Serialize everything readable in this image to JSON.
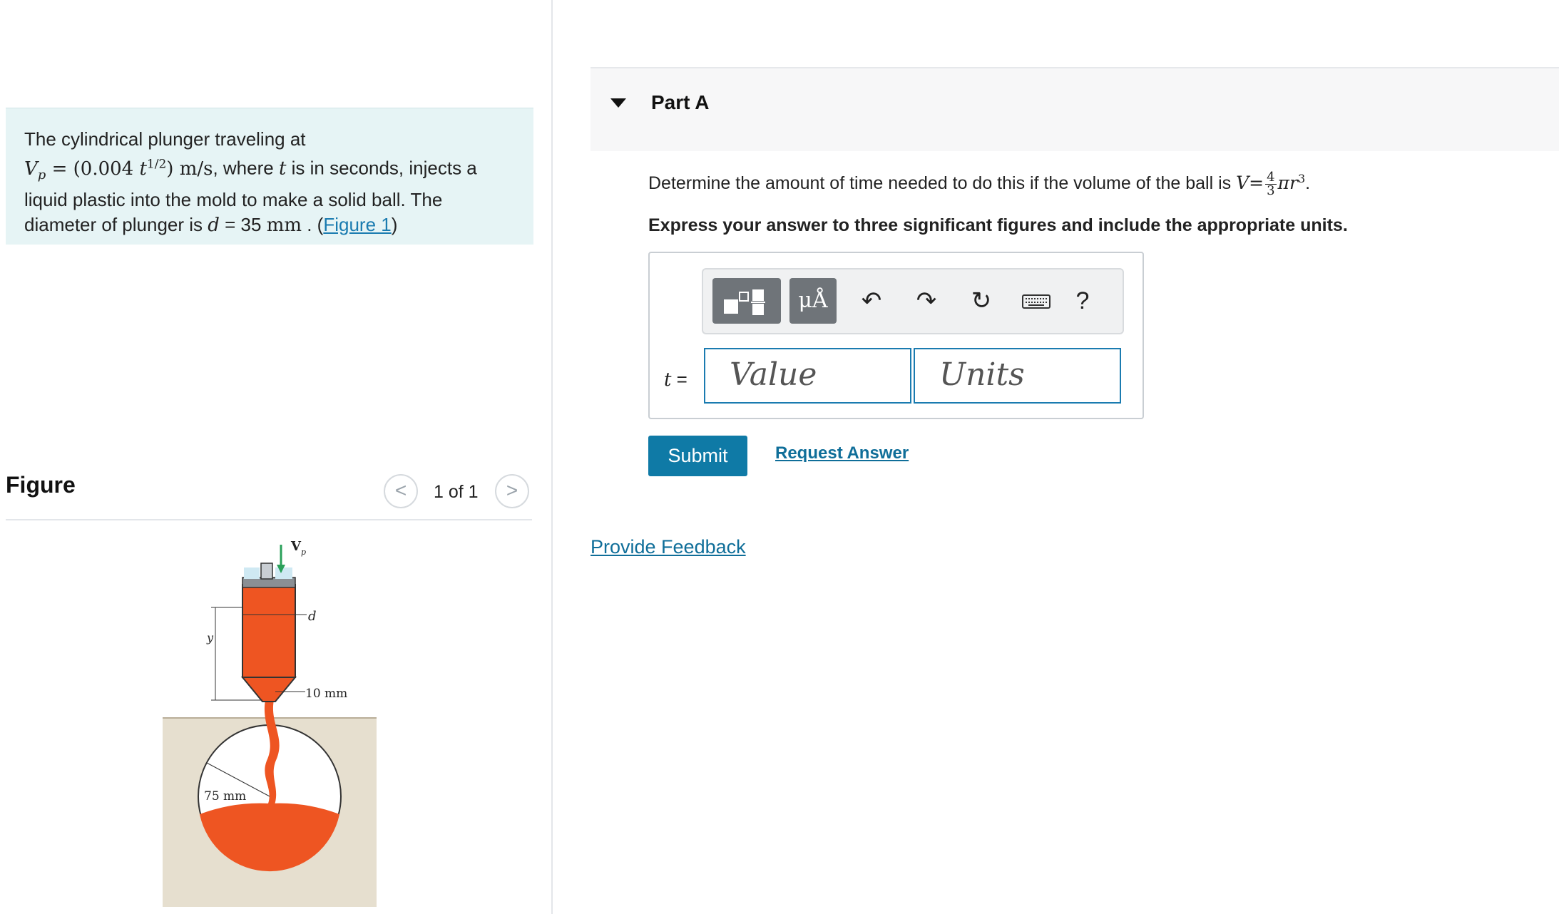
{
  "problem": {
    "intro": "The cylindrical plunger traveling at",
    "speed_var": "V",
    "speed_sub": "p",
    "speed_expr_open": " = (0.004 ",
    "speed_t": "t",
    "speed_exp": "1/2",
    "speed_expr_close": ") m/s",
    "after_speed": ", where ",
    "t_var": "t",
    "after_t": " is in seconds, injects a liquid plastic into the mold to make a solid ball. The diameter of plunger is ",
    "d_var": "d",
    "d_value": " = 35 ",
    "d_unit": "mm",
    "sep": " . (",
    "figure_link": "Figure 1",
    "close": ")"
  },
  "figure": {
    "title": "Figure",
    "pager_text": "1 of 1",
    "prev_symbol": "<",
    "next_symbol": ">",
    "labels": {
      "vp": "V",
      "vp_sub": "p",
      "d": "d",
      "y": "y",
      "nozzle": "10 mm",
      "radius": "75 mm"
    }
  },
  "part": {
    "title": "Part A",
    "question_prefix": "Determine the amount of time needed to do this if the volume of the ball is ",
    "v_var": "V",
    "eq": "=",
    "frac_num": "4",
    "frac_den": "3",
    "pi_r": "πr",
    "r_exp": "3",
    "question_suffix": ".",
    "instruction": "Express your answer to three significant figures and include the appropriate units."
  },
  "answer": {
    "var_label": "t",
    "eq_label": " =",
    "value_placeholder": "Value",
    "units_placeholder": "Units",
    "toolbar": {
      "units_label": "μÅ",
      "undo_symbol": "↶",
      "redo_symbol": "↷",
      "reset_symbol": "↻",
      "help_symbol": "?"
    }
  },
  "actions": {
    "submit": "Submit",
    "request_answer": "Request Answer",
    "provide_feedback": "Provide Feedback"
  },
  "colors": {
    "accent": "#0f7aa6",
    "problem_bg": "#e6f4f5",
    "plastic": "#ee5522"
  }
}
